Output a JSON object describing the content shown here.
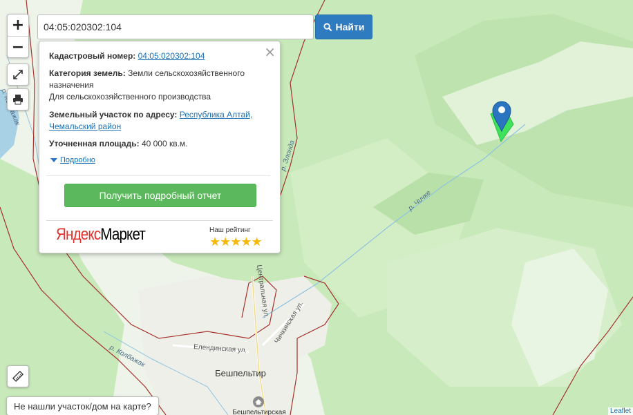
{
  "map": {
    "labels": {
      "river_kolbazhak": "р. Колбажак",
      "river_kolbazhak_lower": "р. Колбажак",
      "river_elonda": "р. Элонда",
      "river_chichke": "р. Чичке",
      "street_centralnaya": "Центральная ул.",
      "street_chichkinskaya": "Чичкинская ул.",
      "street_elendinskaya": "Елендинская ул.",
      "village": "Бешпельтир",
      "school": "Бешпельтирская"
    },
    "colors": {
      "forest": "#c5e8b6",
      "forest_light": "#d6efc9",
      "open": "#eef4e9",
      "boundary": "#a5302c",
      "parcel": "#3fe05a",
      "marker": "#2a74c0",
      "water": "#a9d1e6"
    }
  },
  "controls": {
    "zoom_in": "+",
    "zoom_out": "−",
    "fullscreen_icon": "expand-icon",
    "print_icon": "printer-icon",
    "ruler_icon": "ruler-icon"
  },
  "search": {
    "value": "04:05:020302:104",
    "button_label": "Найти",
    "button_icon": "search-icon"
  },
  "popup": {
    "cadastral_label": "Кадастровый номер:",
    "cadastral_value": "04:05:020302:104",
    "category_label": "Категория земель:",
    "category_value": "Земли сельскохозяйственного назначения",
    "usage": "Для сельскохозяйственного производства",
    "address_label": "Земельный участок по адресу:",
    "address_value": "Республика Алтай, Чемальский район",
    "area_label": "Уточненная площадь:",
    "area_value": "40 000 кв.м.",
    "details_link": "Подробно",
    "report_button": "Получить подробный отчет",
    "ym_brand_y": "Яндекс",
    "ym_brand_m": "Маркет",
    "rating_label": "Наш рейтинг",
    "stars": "★★★★★",
    "close": "×"
  },
  "not_found": "Не нашли участок/дом на карте?",
  "attribution": "Leaflet"
}
